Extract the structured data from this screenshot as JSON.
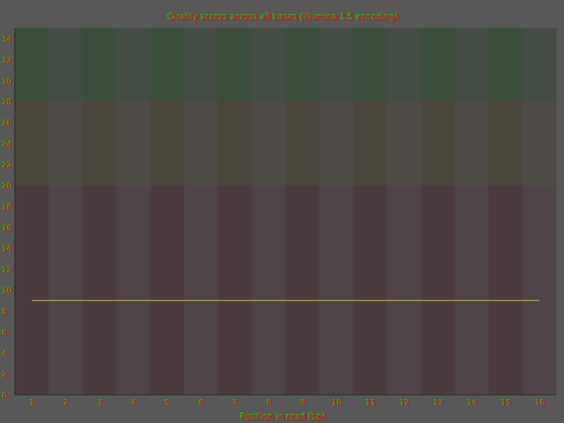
{
  "chart_data": {
    "type": "line",
    "title_green": "Quality scores across all bases (Illumina 1.5 encoding)",
    "title_red": "Quality scores across all bases (Illumina 1.5 encoding)",
    "xlabel_green": "Position in read (bp)",
    "xlabel_red": "Position in read (bp)",
    "x": [
      1,
      2,
      3,
      4,
      5,
      6,
      7,
      8,
      9,
      10,
      11,
      12,
      13,
      14,
      15,
      16
    ],
    "ylim": [
      0,
      35
    ],
    "yticks": [
      0,
      2,
      4,
      6,
      8,
      10,
      12,
      14,
      16,
      18,
      20,
      22,
      24,
      26,
      28,
      30,
      32,
      34
    ],
    "series": [
      {
        "values": [
          9,
          9,
          9,
          9,
          9,
          9,
          9,
          9,
          9,
          9,
          9,
          9,
          9,
          9,
          9,
          9
        ],
        "color": "#e0e000"
      }
    ],
    "quality_bands": [
      {
        "from": 0,
        "to": 20,
        "colors": [
          "#4b3b3e",
          "#4f4548"
        ]
      },
      {
        "from": 20,
        "to": 28,
        "colors": [
          "#4b463c",
          "#4e4a45"
        ]
      },
      {
        "from": 28,
        "to": 35,
        "colors": [
          "#3b4d3b",
          "#434c43"
        ]
      }
    ],
    "colors": {
      "background": "#585858",
      "green_text": "#00dd00",
      "red_text": "#ee0000",
      "axis": "#222222"
    }
  }
}
